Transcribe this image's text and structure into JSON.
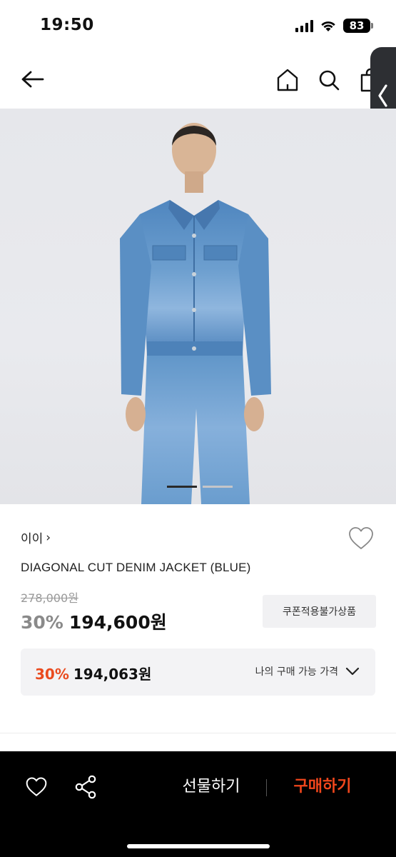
{
  "status_bar": {
    "time": "19:50",
    "battery": "83"
  },
  "product": {
    "brand": "이이",
    "brand_chevron": "›",
    "name": "DIAGONAL CUT DENIM JACKET (BLUE)",
    "original_price": "278,000원",
    "discount": "30%",
    "sale_price": "194,600원",
    "coupon_badge": "쿠폰적용불가상품"
  },
  "my_price": {
    "discount": "30%",
    "price": "194,063원",
    "label": "나의 구매 가능 가격"
  },
  "gallery": {
    "slide_count": 2,
    "active_index": 0
  },
  "bottom_bar": {
    "gift_label": "선물하기",
    "buy_label": "구매하기"
  },
  "colors": {
    "accent": "#ea4b1f",
    "buy": "#f0461c",
    "bar": "#000000"
  },
  "icons": [
    "back-arrow-icon",
    "home-icon",
    "search-icon",
    "shopping-bag-icon",
    "heart-icon",
    "share-icon",
    "chevron-down-icon",
    "chevron-left-icon"
  ]
}
